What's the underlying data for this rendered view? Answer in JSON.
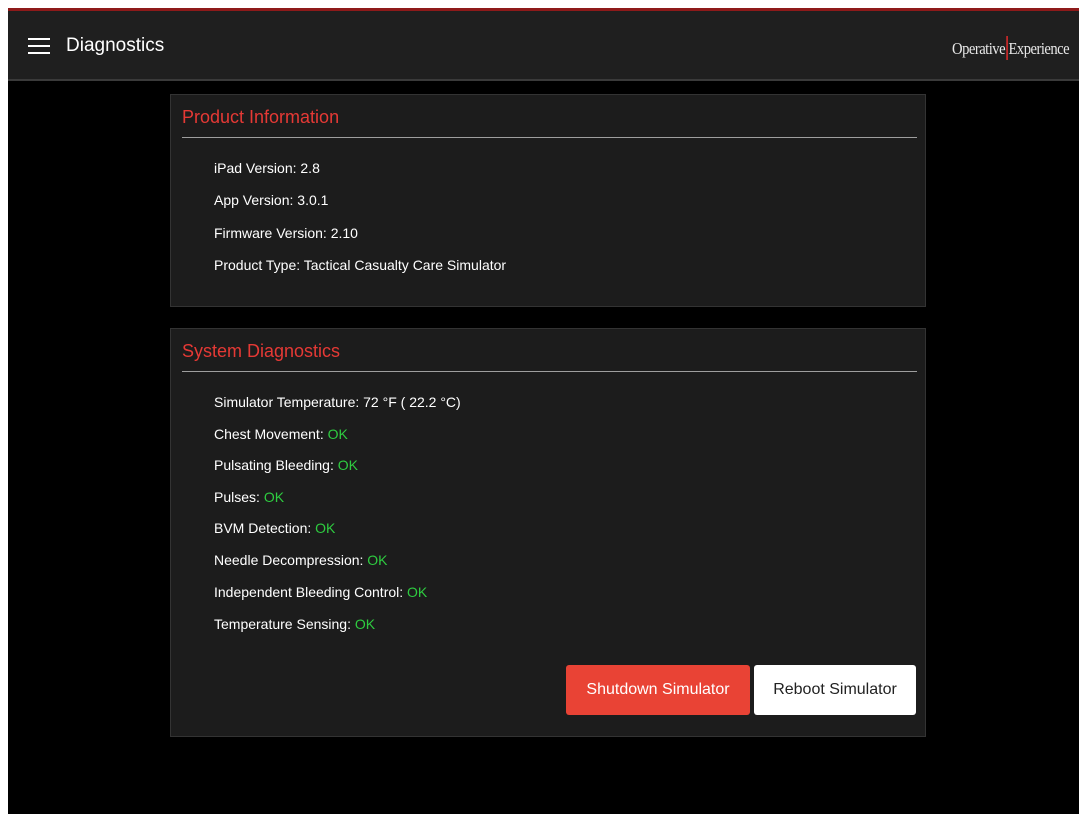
{
  "header": {
    "title": "Diagnostics",
    "brand_left": "Operative",
    "brand_right": "Experience"
  },
  "product_info": {
    "title": "Product Information",
    "rows": [
      {
        "label": "iPad Version: ",
        "value": "2.8"
      },
      {
        "label": "App Version: ",
        "value": "3.0.1"
      },
      {
        "label": "Firmware Version: ",
        "value": "2.10"
      },
      {
        "label": "Product Type: ",
        "value": "Tactical Casualty Care Simulator"
      }
    ]
  },
  "system_diagnostics": {
    "title": "System Diagnostics",
    "temperature": {
      "label": "Simulator Temperature: ",
      "value": "72 °F ( 22.2 °C)"
    },
    "checks": [
      {
        "label": "Chest Movement: ",
        "status": "OK"
      },
      {
        "label": "Pulsating Bleeding: ",
        "status": "OK"
      },
      {
        "label": "Pulses: ",
        "status": "OK"
      },
      {
        "label": "BVM Detection: ",
        "status": "OK"
      },
      {
        "label": "Needle Decompression: ",
        "status": "OK"
      },
      {
        "label": "Independent Bleeding Control: ",
        "status": "OK"
      },
      {
        "label": "Temperature Sensing: ",
        "status": "OK"
      }
    ],
    "shutdown_label": "Shutdown Simulator",
    "reboot_label": "Reboot Simulator"
  },
  "colors": {
    "accent_red": "#e53935",
    "status_ok": "#2ecc40",
    "background": "#000000",
    "card": "#1c1c1c"
  }
}
